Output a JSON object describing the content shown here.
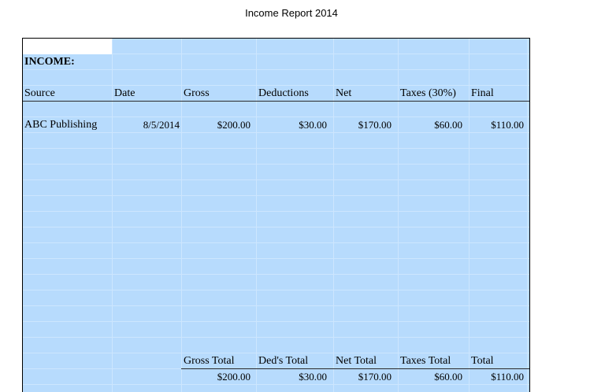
{
  "report": {
    "title": "Income Report 2014"
  },
  "section": {
    "label": "INCOME:"
  },
  "headers": [
    "Source",
    "Date",
    "Gross",
    "Deductions",
    "Net",
    "Taxes (30%)",
    "Final"
  ],
  "rows": [
    {
      "source": "ABC Publishing",
      "date": "8/5/2014",
      "gross": "$200.00",
      "deductions": "$30.00",
      "net": "$170.00",
      "taxes": "$60.00",
      "final": "$110.00"
    }
  ],
  "totals": {
    "headers": [
      "Gross Total",
      "Ded's Total",
      "Net Total",
      "Taxes Total",
      "Total"
    ],
    "values": [
      "$200.00",
      "$30.00",
      "$170.00",
      "$60.00",
      "$110.00"
    ]
  },
  "colors": {
    "cell_fill": "#b7dbfd",
    "gridline": "#cde6fe"
  }
}
